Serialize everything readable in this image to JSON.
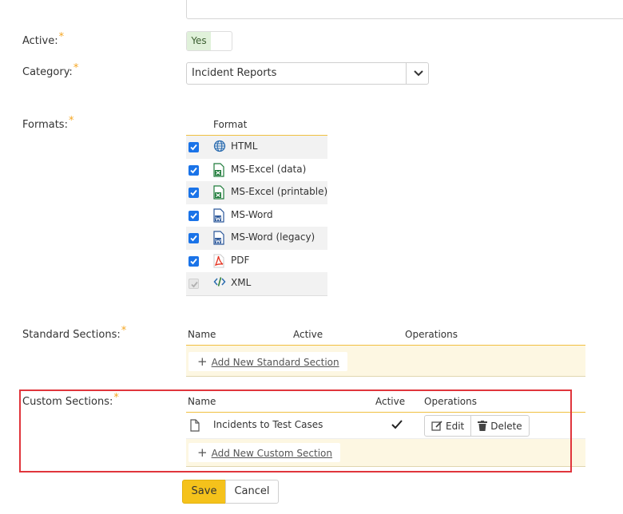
{
  "fields": {
    "active": {
      "label": "Active:",
      "value": "Yes",
      "toggle_on": true
    },
    "category": {
      "label": "Category:",
      "selected": "Incident Reports"
    },
    "formats": {
      "label": "Formats:"
    },
    "standard_sections": {
      "label": "Standard Sections:"
    },
    "custom_sections": {
      "label": "Custom Sections:"
    }
  },
  "required_mark": "*",
  "formats_table": {
    "header": "Format",
    "rows": [
      {
        "name": "HTML",
        "checked": true,
        "disabled": false,
        "icon": "globe-icon",
        "color": "#2b6cb0"
      },
      {
        "name": "MS-Excel (data)",
        "checked": true,
        "disabled": false,
        "icon": "excel-icon",
        "color": "#1e7b3a"
      },
      {
        "name": "MS-Excel (printable)",
        "checked": true,
        "disabled": false,
        "icon": "excel-icon",
        "color": "#1e7b3a"
      },
      {
        "name": "MS-Word",
        "checked": true,
        "disabled": false,
        "icon": "word-icon",
        "color": "#2b579a"
      },
      {
        "name": "MS-Word (legacy)",
        "checked": true,
        "disabled": false,
        "icon": "word-icon",
        "color": "#2b579a"
      },
      {
        "name": "PDF",
        "checked": true,
        "disabled": false,
        "icon": "pdf-icon",
        "color": "#e5321f"
      },
      {
        "name": "XML",
        "checked": true,
        "disabled": true,
        "icon": "code-icon",
        "color": "#444444"
      }
    ]
  },
  "standard_table": {
    "headers": {
      "name": "Name",
      "active": "Active",
      "operations": "Operations"
    },
    "add_label": "Add New Standard Section"
  },
  "custom_table": {
    "headers": {
      "name": "Name",
      "active": "Active",
      "operations": "Operations"
    },
    "rows": [
      {
        "name": "Incidents to Test Cases",
        "active": true,
        "edit": "Edit",
        "delete": "Delete"
      }
    ],
    "add_label": "Add New Custom Section"
  },
  "buttons": {
    "save": "Save",
    "cancel": "Cancel"
  },
  "colors": {
    "accent": "#f5c21b",
    "highlight": "#e0353c",
    "required": "#f5a623",
    "checkbox": "#1a73e8"
  }
}
